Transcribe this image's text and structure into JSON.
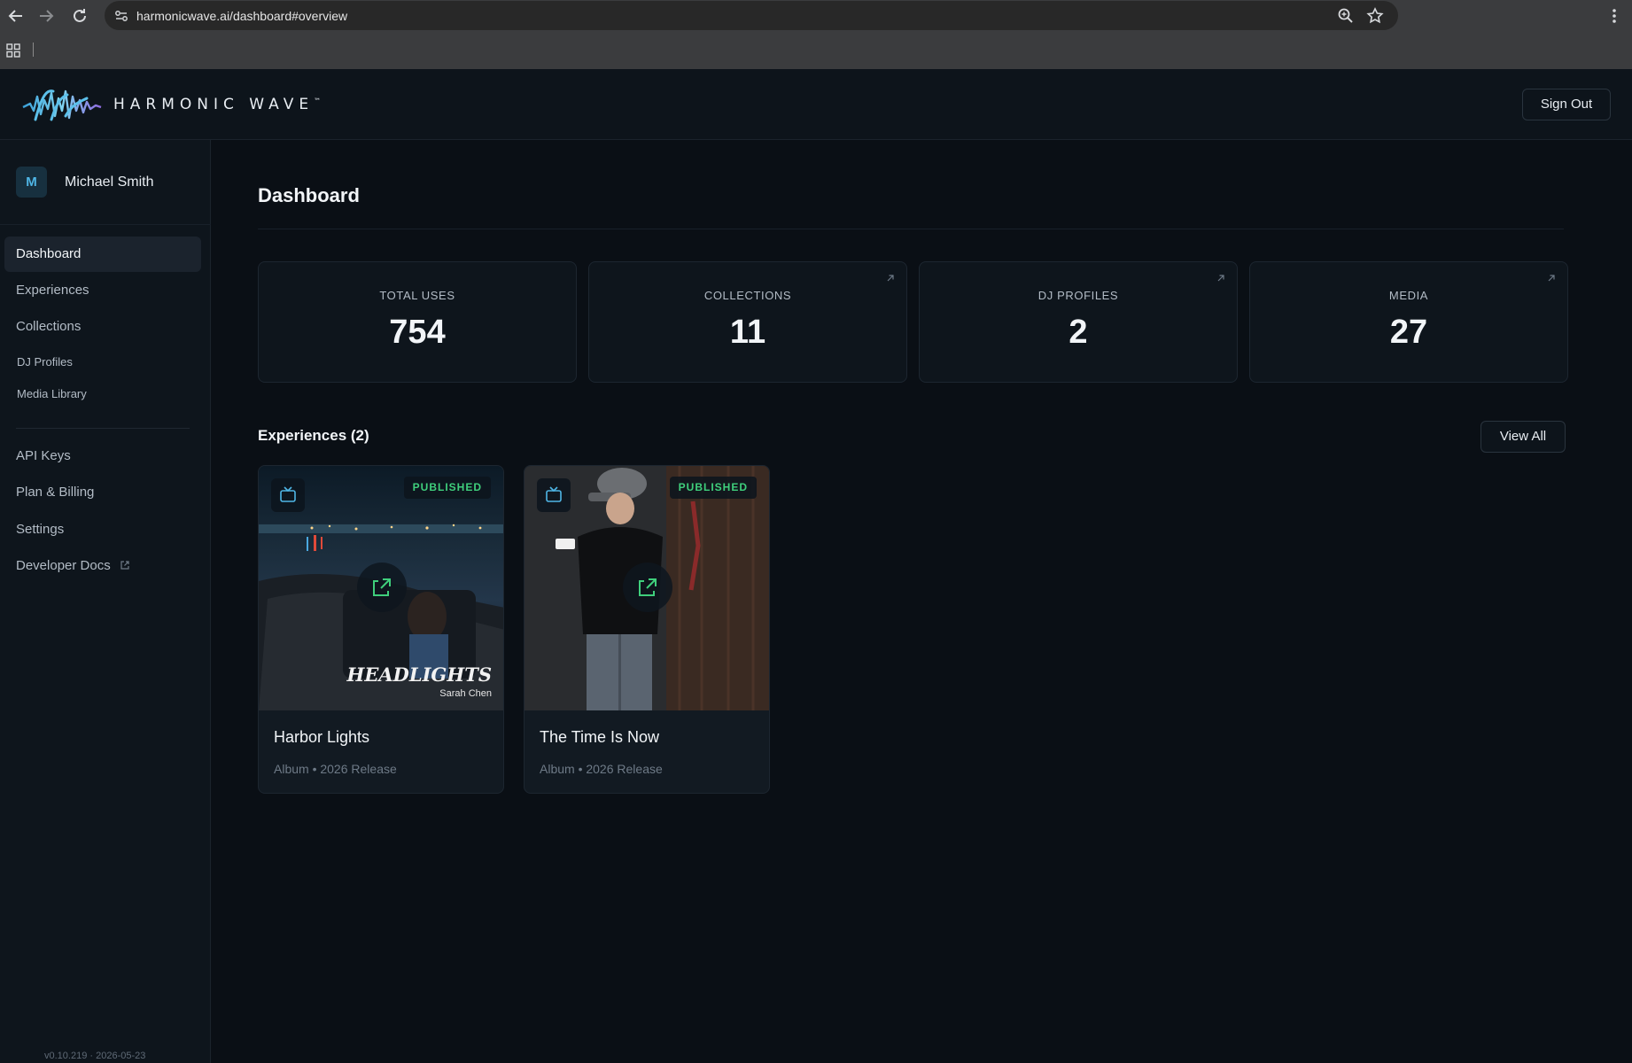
{
  "browser": {
    "url": "harmonicwave.ai/dashboard#overview"
  },
  "header": {
    "brand": "HARMONIC WAVE",
    "trademark": "™",
    "sign_out_label": "Sign Out"
  },
  "sidebar": {
    "user": {
      "initial": "M",
      "name": "Michael Smith"
    },
    "items": [
      {
        "label": "Dashboard",
        "active": true
      },
      {
        "label": "Experiences"
      },
      {
        "label": "Collections"
      },
      {
        "label": "DJ Profiles"
      },
      {
        "label": "Media Library"
      },
      {
        "label": "API Keys"
      },
      {
        "label": "Plan & Billing"
      },
      {
        "label": "Settings"
      },
      {
        "label": "Developer Docs",
        "icon": "external-link-icon"
      }
    ],
    "version": "v0.10.219 · 2026-05-23"
  },
  "main": {
    "title": "Dashboard",
    "stats": [
      {
        "label": "TOTAL USES",
        "value": "754"
      },
      {
        "label": "COLLECTIONS",
        "value": "11",
        "icon": "arrow-up-right-icon"
      },
      {
        "label": "DJ PROFILES",
        "value": "2",
        "icon": "arrow-up-right-icon"
      },
      {
        "label": "MEDIA",
        "value": "27",
        "icon": "arrow-up-right-icon"
      }
    ],
    "experiences": {
      "title": "Experiences (2)",
      "view_all_label": "View All",
      "items": [
        {
          "title": "Harbor Lights",
          "meta": "Album • 2026 Release",
          "badge": "PUBLISHED",
          "art_title": "HEADLIGHTS",
          "art_artist": "Sarah Chen"
        },
        {
          "title": "The Time Is Now",
          "meta": "Album • 2026 Release",
          "badge": "PUBLISHED"
        }
      ]
    }
  },
  "colors": {
    "accent_green": "#3fcf7c",
    "accent_blue": "#4fb6e6",
    "background": "#0a0f15"
  }
}
